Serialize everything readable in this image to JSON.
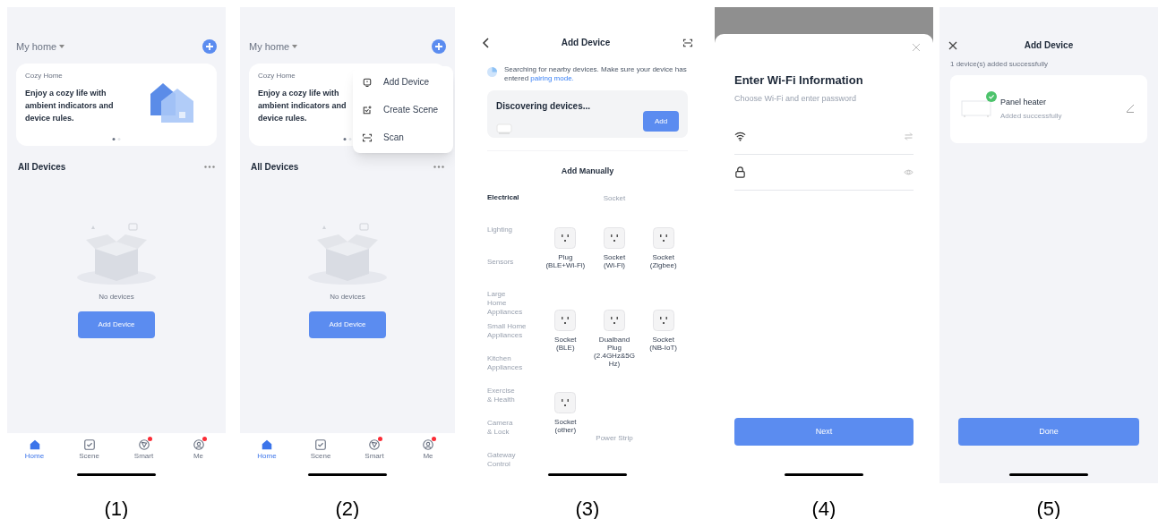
{
  "panels": [
    {
      "kind": "home",
      "caption": "(1)",
      "home": "My home",
      "banner": {
        "label": "Cozy Home",
        "text": "Enjoy a cozy life with ambient indicators and device rules.",
        "dots": [
          {
            "selected": true
          },
          {
            "selected": false
          }
        ]
      },
      "section": "All Devices",
      "empty_text": "No devices",
      "button": "Add Device",
      "tabs": [
        {
          "kind": "home",
          "label": "Home",
          "selected": true,
          "badge": false
        },
        {
          "kind": "scene",
          "label": "Scene",
          "selected": false,
          "badge": false
        },
        {
          "kind": "smart",
          "label": "Smart",
          "selected": false,
          "badge": true
        },
        {
          "kind": "me",
          "label": "Me",
          "selected": false,
          "badge": true
        }
      ]
    },
    {
      "kind": "home",
      "caption": "(2)",
      "home": "My home",
      "banner": {
        "label": "Cozy Home",
        "text": "Enjoy a cozy life with ambient indicators and device rules.",
        "dots": [
          {
            "selected": true
          },
          {
            "selected": false
          }
        ]
      },
      "section": "All Devices",
      "empty_text": "No devices",
      "button": "Add Device",
      "tabs": [
        {
          "kind": "home",
          "label": "Home",
          "selected": true,
          "badge": false
        },
        {
          "kind": "scene",
          "label": "Scene",
          "selected": false,
          "badge": false
        },
        {
          "kind": "smart",
          "label": "Smart",
          "selected": false,
          "badge": true
        },
        {
          "kind": "me",
          "label": "Me",
          "selected": false,
          "badge": true
        }
      ],
      "menu": [
        {
          "kind": "device",
          "label": "Add Device"
        },
        {
          "kind": "scene",
          "label": "Create Scene"
        },
        {
          "kind": "scan",
          "label": "Scan"
        }
      ]
    },
    {
      "kind": "add_device",
      "caption": "(3)",
      "title": "Add Device",
      "notice": "Searching for nearby devices. Make sure your device has entered",
      "notice_link": "pairing mode.",
      "discovering": "Discovering devices...",
      "add_button": "Add",
      "manual_title": "Add Manually",
      "categories": [
        {
          "label": "Electrical",
          "selected": true
        },
        {
          "label": "Lighting",
          "selected": false
        },
        {
          "label": "Sensors",
          "selected": false
        },
        {
          "label": "Large\nHome\nAppliances",
          "selected": false
        },
        {
          "label": "Small Home\nAppliances",
          "selected": false
        },
        {
          "label": "Kitchen\nAppliances",
          "selected": false
        },
        {
          "label": "Exercise\n& Health",
          "selected": false
        },
        {
          "label": "Camera\n& Lock",
          "selected": false
        },
        {
          "label": "Gateway\nControl",
          "selected": false
        }
      ],
      "group_title": "Socket",
      "devices": [
        "Plug\n(BLE+Wi-Fi)",
        "Socket\n(Wi-Fi)",
        "Socket\n(Zigbee)",
        "Socket\n(BLE)",
        "Dualband\nPlug\n(2.4GHz&5G\nHz)",
        "Socket\n(NB-IoT)",
        "Socket\n(other)"
      ],
      "next_group": "Power Strip"
    },
    {
      "kind": "wifi",
      "caption": "(4)",
      "title": "Enter Wi-Fi Information",
      "subtitle": "Choose Wi-Fi and enter password",
      "fields": [
        {
          "kind": "wifi"
        },
        {
          "kind": "password"
        }
      ],
      "button": "Next"
    },
    {
      "kind": "done",
      "caption": "(5)",
      "title": "Add Device",
      "summary": "1 device(s) added successfully",
      "device": {
        "name": "Panel heater",
        "status": "Added successfully"
      },
      "button": "Done"
    }
  ]
}
